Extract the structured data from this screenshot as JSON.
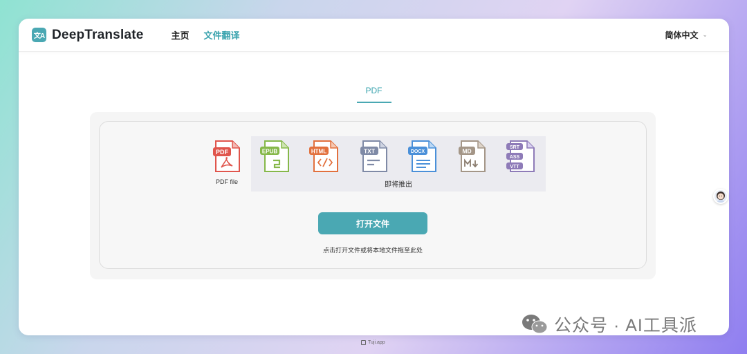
{
  "app": {
    "logo_text": "DeepTranslate",
    "logo_icon": "translate-icon"
  },
  "nav": {
    "items": [
      {
        "label": "主页"
      },
      {
        "label": "文件翻译"
      }
    ],
    "active_index": 1
  },
  "language": {
    "label": "简体中文"
  },
  "tabs": [
    {
      "label": "PDF"
    }
  ],
  "formats": {
    "supported": [
      {
        "badge": "PDF",
        "label": "PDF file",
        "color": "#e0554c"
      }
    ],
    "coming_soon": [
      {
        "badge": "EPUB",
        "color": "#86b84a"
      },
      {
        "badge": "HTML",
        "color": "#e2703d"
      },
      {
        "badge": "TXT",
        "color": "#7f8aa6"
      },
      {
        "badge": "DOCX",
        "color": "#4a90d9"
      },
      {
        "badge": "MD",
        "color": "#a49687"
      },
      {
        "badges": [
          "SRT",
          "ASS",
          "VTT"
        ],
        "color": "#8e7bb8"
      }
    ],
    "coming_label": "即将推出"
  },
  "actions": {
    "open_file": "打开文件",
    "hint": "点击打开文件或将本地文件拖至此处"
  },
  "watermark": {
    "text": "公众号 · AI工具派"
  },
  "footer": {
    "text": "Tuji.app"
  },
  "colors": {
    "accent": "#4aa8b3",
    "accent_text": "#3aa3ae"
  }
}
